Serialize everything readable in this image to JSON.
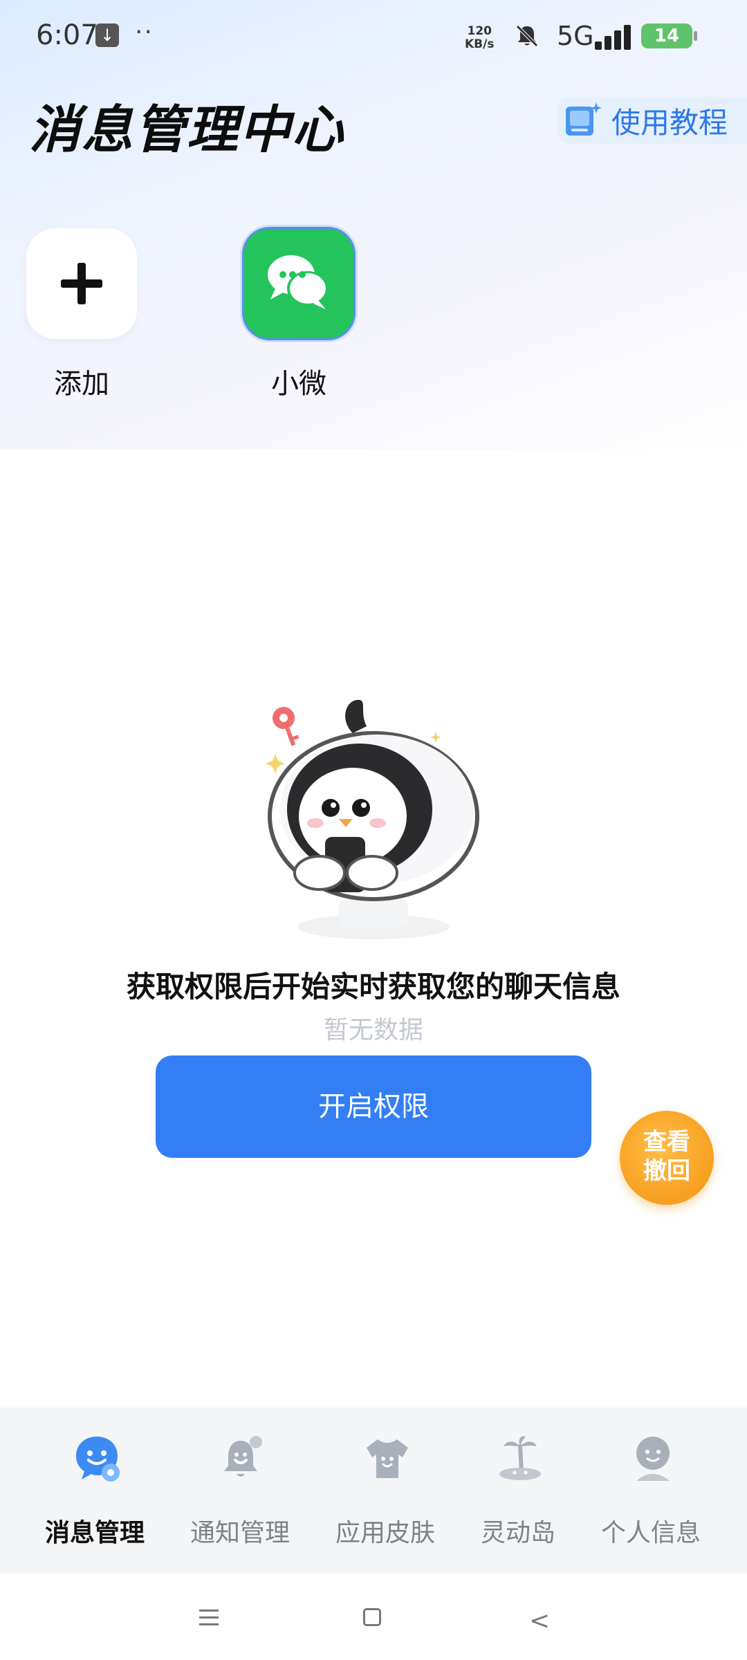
{
  "status_bar": {
    "time": "6:07",
    "download_icon": "download-arrow-icon",
    "dots": "··",
    "net_speed_value": "120",
    "net_speed_unit": "KB/s",
    "network": "5G",
    "battery": "14"
  },
  "header": {
    "title": "消息管理中心",
    "tutorial_label": "使用教程",
    "tutorial_icon": "book-icon"
  },
  "apps": [
    {
      "label": "添加",
      "icon": "plus-icon"
    },
    {
      "label": "小微",
      "icon": "chat-bubbles-icon",
      "color": "#23c45b"
    }
  ],
  "empty_state": {
    "illustration": "penguin-with-phone",
    "message": "获取权限后开始实时获取您的聊天信息",
    "sub": "暂无数据",
    "button_label": "开启权限"
  },
  "recall_fab": {
    "line1": "查看",
    "line2": "撤回"
  },
  "bottom_nav": {
    "items": [
      {
        "label": "消息管理",
        "icon": "message-manage-icon",
        "active": true
      },
      {
        "label": "通知管理",
        "icon": "bell-icon",
        "active": false
      },
      {
        "label": "应用皮肤",
        "icon": "tshirt-icon",
        "active": false
      },
      {
        "label": "灵动岛",
        "icon": "island-icon",
        "active": false
      },
      {
        "label": "个人信息",
        "icon": "profile-icon",
        "active": false
      }
    ]
  },
  "colors": {
    "accent": "#337ef5",
    "wechat_green": "#23c45b",
    "fab_orange": "#f8a020"
  }
}
